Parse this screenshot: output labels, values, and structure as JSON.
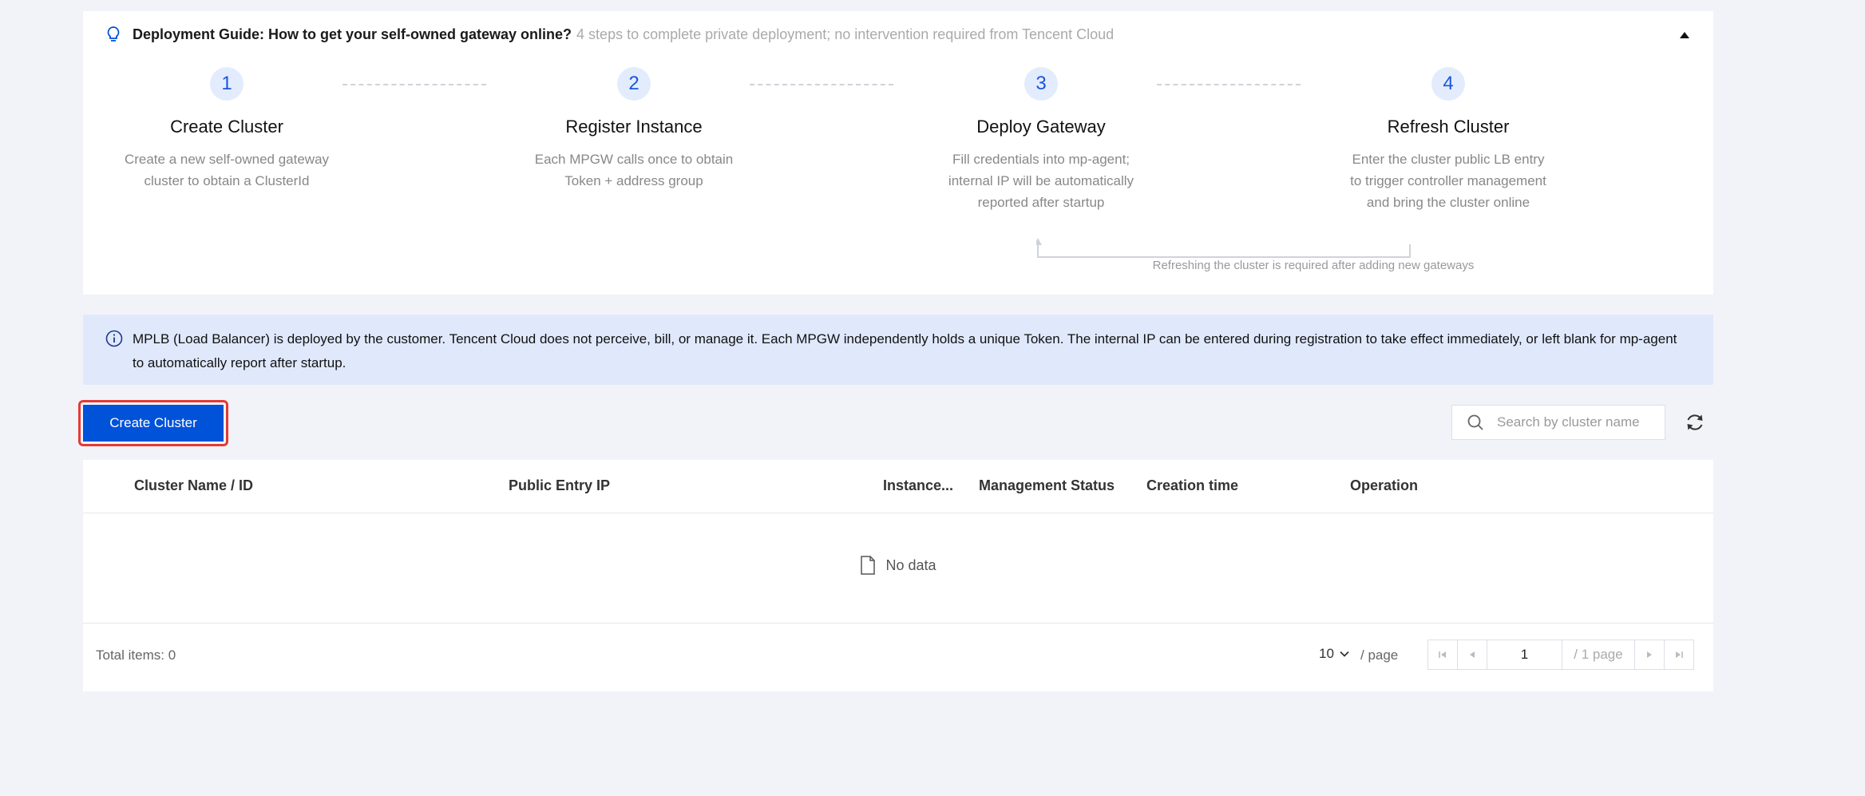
{
  "guide": {
    "title": "Deployment Guide: How to get your self-owned gateway online?",
    "subtitle": "4 steps to complete private deployment; no intervention required from Tencent Cloud",
    "steps": [
      {
        "number": "1",
        "title": "Create Cluster",
        "desc": [
          "Create a new self-owned gateway",
          "cluster to obtain a ClusterId"
        ]
      },
      {
        "number": "2",
        "title": "Register Instance",
        "desc": [
          "Each MPGW calls once to obtain",
          "Token + address group"
        ]
      },
      {
        "number": "3",
        "title": "Deploy Gateway",
        "desc": [
          "Fill credentials into mp-agent;",
          "internal IP will be automatically",
          "reported after startup"
        ]
      },
      {
        "number": "4",
        "title": "Refresh Cluster",
        "desc": [
          "Enter the cluster public LB entry",
          "to trigger controller management",
          "and bring the cluster online"
        ]
      }
    ],
    "refresh_note": "Refreshing the cluster is required after adding new gateways"
  },
  "info": {
    "text": "MPLB (Load Balancer) is deployed by the customer. Tencent Cloud does not perceive, bill, or manage it. Each MPGW independently holds a unique Token. The internal IP can be entered during registration to take effect immediately, or left blank for mp-agent to automatically report after startup."
  },
  "toolbar": {
    "create_label": "Create Cluster",
    "search_placeholder": "Search by cluster name",
    "search_value": ""
  },
  "table": {
    "columns": [
      "Cluster Name / ID",
      "Public Entry IP",
      "Instance...",
      "Management Status",
      "Creation time",
      "Operation"
    ],
    "rows": [],
    "empty_text": "No data"
  },
  "pagination": {
    "total": "Total items: 0",
    "page_size": "10",
    "per_page_label": "/ page",
    "current_page": "1",
    "total_pages": "/ 1 page"
  },
  "colors": {
    "primary": "#0052d9",
    "highlight": "#e53935",
    "info_bg": "#e0e9fc",
    "step_circle_bg": "#e3ecfd"
  },
  "icons": [
    "lightbulb-icon",
    "caret-up-icon",
    "info-icon",
    "search-icon",
    "refresh-icon",
    "file-icon",
    "chevron-down-icon",
    "first-page-icon",
    "prev-page-icon",
    "next-page-icon",
    "last-page-icon"
  ]
}
